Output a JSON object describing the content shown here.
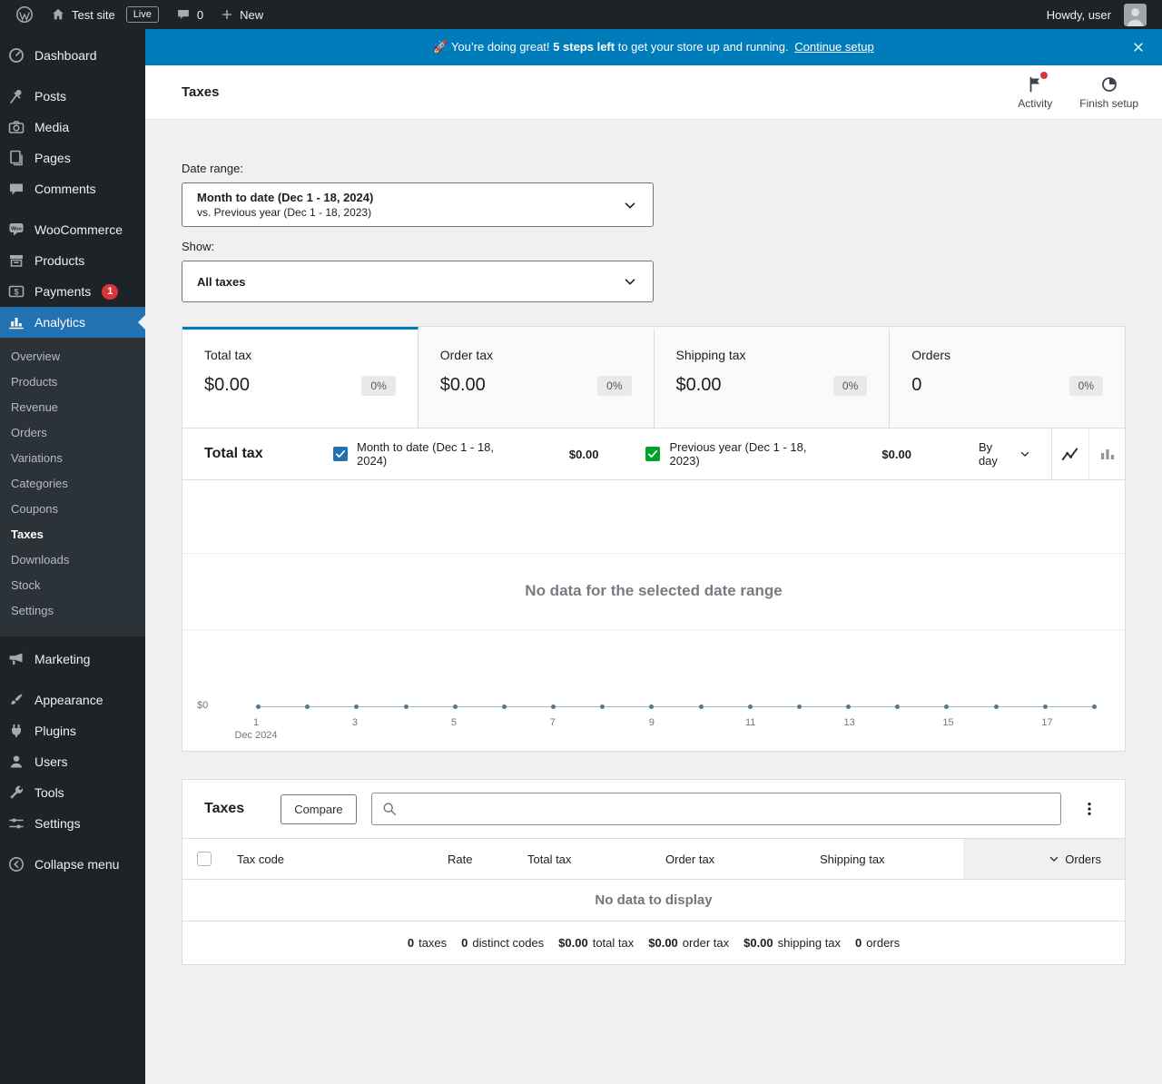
{
  "colors": {
    "accent": "#007cba",
    "active_menu": "#2271b1",
    "notification": "#d63638",
    "series_primary": "#2271b1",
    "series_secondary": "#00a32a"
  },
  "admin_bar": {
    "site_name": "Test site",
    "live_badge": "Live",
    "comments_count": "0",
    "new_label": "New",
    "howdy": "Howdy, user"
  },
  "banner": {
    "rocket": "🚀",
    "message_intro": "You’re doing great!",
    "steps_left": "5 steps left",
    "message_rest": "to get your store up and running.",
    "link_label": "Continue setup"
  },
  "sidebar": {
    "items": [
      {
        "label": "Dashboard"
      },
      {
        "label": "Posts"
      },
      {
        "label": "Media"
      },
      {
        "label": "Pages"
      },
      {
        "label": "Comments"
      },
      {
        "label": "WooCommerce"
      },
      {
        "label": "Products"
      },
      {
        "label": "Payments",
        "badge": "1"
      },
      {
        "label": "Analytics"
      },
      {
        "label": "Marketing"
      },
      {
        "label": "Appearance"
      },
      {
        "label": "Plugins"
      },
      {
        "label": "Users"
      },
      {
        "label": "Tools"
      },
      {
        "label": "Settings"
      },
      {
        "label": "Collapse menu"
      }
    ],
    "analytics_submenu": [
      "Overview",
      "Products",
      "Revenue",
      "Orders",
      "Variations",
      "Categories",
      "Coupons",
      "Taxes",
      "Downloads",
      "Stock",
      "Settings"
    ]
  },
  "header": {
    "title": "Taxes",
    "activity_label": "Activity",
    "finish_setup_label": "Finish setup"
  },
  "filters": {
    "date_range_label": "Date range:",
    "date_range_value": "Month to date (Dec 1 - 18, 2024)",
    "date_range_compare": "vs. Previous year (Dec 1 - 18, 2023)",
    "show_label": "Show:",
    "show_value": "All taxes"
  },
  "summary_cards": [
    {
      "label": "Total tax",
      "value": "$0.00",
      "delta": "0%"
    },
    {
      "label": "Order tax",
      "value": "$0.00",
      "delta": "0%"
    },
    {
      "label": "Shipping tax",
      "value": "$0.00",
      "delta": "0%"
    },
    {
      "label": "Orders",
      "value": "0",
      "delta": "0%"
    }
  ],
  "chart": {
    "title": "Total tax",
    "series": [
      {
        "label": "Month to date (Dec 1 - 18, 2024)",
        "value": "$0.00"
      },
      {
        "label": "Previous year (Dec 1 - 18, 2023)",
        "value": "$0.00"
      }
    ],
    "interval": "By day",
    "empty_message": "No data for the selected date range",
    "y_zero_label": "$0",
    "x_ticks": [
      "1",
      "3",
      "5",
      "7",
      "9",
      "11",
      "13",
      "15",
      "17"
    ],
    "x_month_label": "Dec 2024"
  },
  "table": {
    "title": "Taxes",
    "compare_label": "Compare",
    "columns": [
      "Tax code",
      "Rate",
      "Total tax",
      "Order tax",
      "Shipping tax",
      "Orders"
    ],
    "empty_message": "No data to display",
    "summary": [
      {
        "value": "0",
        "label": "taxes"
      },
      {
        "value": "0",
        "label": "distinct codes"
      },
      {
        "value": "$0.00",
        "label": "total tax"
      },
      {
        "value": "$0.00",
        "label": "order tax"
      },
      {
        "value": "$0.00",
        "label": "shipping tax"
      },
      {
        "value": "0",
        "label": "orders"
      }
    ]
  }
}
